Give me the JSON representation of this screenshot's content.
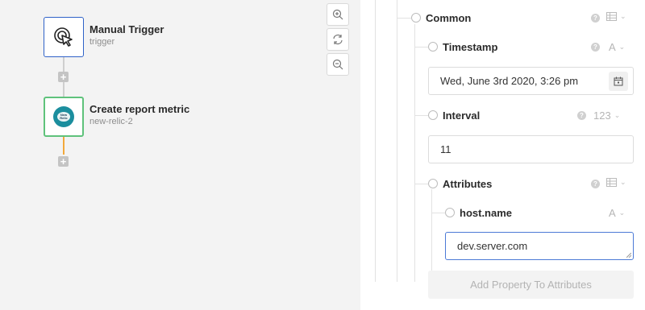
{
  "workflow": {
    "nodes": [
      {
        "title": "Manual Trigger",
        "subtitle": "trigger",
        "icon": "pointer-click-icon"
      },
      {
        "title": "Create report metric",
        "subtitle": "new-relic-2",
        "icon": "new-relic-logo",
        "logo_text": "New Relic"
      }
    ],
    "add_step_symbol": "+",
    "zoom_controls": [
      "zoom-in-icon",
      "reset-zoom-icon",
      "zoom-out-icon"
    ],
    "colors": {
      "trigger_border": "#2f62c8",
      "action_border": "#5fc27b",
      "connector_active": "#f2a93b"
    }
  },
  "form": {
    "common": {
      "label": "Common",
      "type": "table-icon"
    },
    "timestamp": {
      "label": "Timestamp",
      "type": "A",
      "value": "Wed, June 3rd 2020, 3:26 pm"
    },
    "interval": {
      "label": "Interval",
      "type": "123",
      "value": "11"
    },
    "attributes": {
      "label": "Attributes",
      "type": "table-icon"
    },
    "host_name": {
      "label": "host.name",
      "type": "A",
      "value": "dev.server.com"
    },
    "add_property_label": "Add Property To Attributes",
    "help_symbol": "?",
    "chevron": "⌄"
  }
}
